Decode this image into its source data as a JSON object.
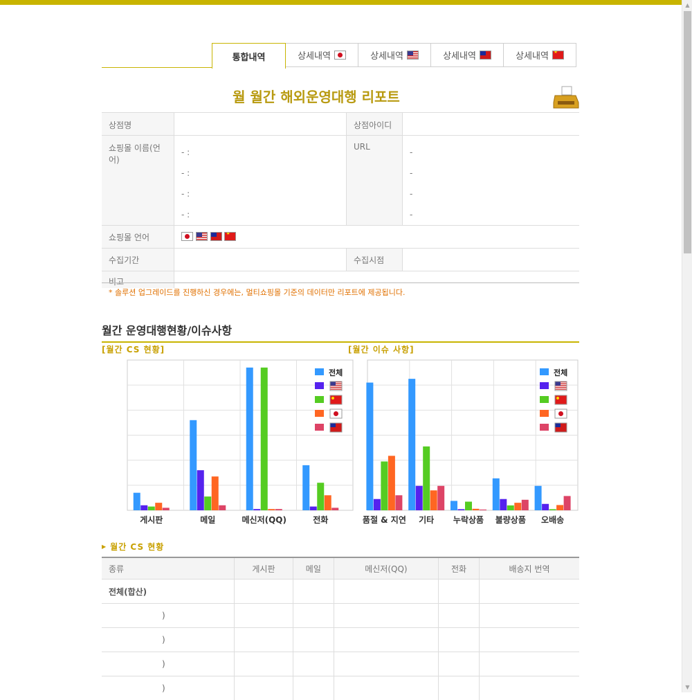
{
  "tabs": [
    {
      "label": "통합내역",
      "flag": "",
      "active": true
    },
    {
      "label": "상세내역",
      "flag": "jp"
    },
    {
      "label": "상세내역",
      "flag": "us"
    },
    {
      "label": "상세내역",
      "flag": "tw"
    },
    {
      "label": "상세내역",
      "flag": "cn"
    }
  ],
  "report_title": "월 월간 해외운영대행 리포트",
  "info": {
    "store_name_label": "상점명",
    "store_id_label": "상점아이디",
    "mall_name_label": "쇼핑몰 이름(언어)",
    "url_label": "URL",
    "mall_lang_label": "쇼핑몰 언어",
    "period_label": "수집기간",
    "collected_label": "수집시점",
    "note_label": "비고",
    "dash": "-",
    "dash_colon": "- :"
  },
  "notice": "* 솔루션 업그레이드를 진행하신 경우에는, 멀티쇼핑몰 기준의 데이터만 리포트에 제공됩니다.",
  "section_title": "월간 운영대행현황/이슈사항",
  "legend_total": "전체",
  "colors": {
    "total": "#3399ff",
    "us": "#5522ee",
    "cn": "#55cc22",
    "jp": "#ff6622",
    "tw": "#dd4466"
  },
  "chart_data": [
    {
      "type": "bar",
      "title": "[월간 CS 현황]",
      "categories": [
        "게시판",
        "메일",
        "메신저(QQ)",
        "전화"
      ],
      "series": [
        {
          "name": "전체",
          "values": [
            7,
            36,
            57,
            18
          ]
        },
        {
          "flag": "us",
          "values": [
            2,
            16,
            0.5,
            1.5
          ]
        },
        {
          "flag": "cn",
          "values": [
            1.5,
            5.5,
            57,
            11
          ]
        },
        {
          "flag": "jp",
          "values": [
            3,
            13.5,
            0.5,
            6
          ]
        },
        {
          "flag": "tw",
          "values": [
            1,
            2,
            0.5,
            1
          ]
        }
      ],
      "ylim": [
        0,
        60
      ]
    },
    {
      "type": "bar",
      "title": "[월간 이슈 사항]",
      "categories": [
        "품절 & 지연",
        "기타",
        "누락상품",
        "불량상품",
        "오배송"
      ],
      "series": [
        {
          "name": "전체",
          "values": [
            34,
            35,
            2.5,
            8.5,
            6.5
          ]
        },
        {
          "flag": "us",
          "values": [
            3,
            6.5,
            0.3,
            3,
            1.7
          ]
        },
        {
          "flag": "cn",
          "values": [
            13,
            17,
            2.3,
            1.3,
            0.3
          ]
        },
        {
          "flag": "jp",
          "values": [
            14.5,
            5.3,
            0.4,
            2,
            1.4
          ]
        },
        {
          "flag": "tw",
          "values": [
            4,
            6.5,
            0.2,
            2.8,
            3.8
          ]
        }
      ],
      "ylim": [
        0,
        40
      ]
    }
  ],
  "cs_table": {
    "title": "월간 CS 현황",
    "headers": [
      "종류",
      "게시판",
      "메일",
      "메신저(QQ)",
      "전화",
      "배송지 번역"
    ],
    "rows": [
      "전체(합산)",
      ")",
      ")",
      ")",
      ")"
    ]
  }
}
